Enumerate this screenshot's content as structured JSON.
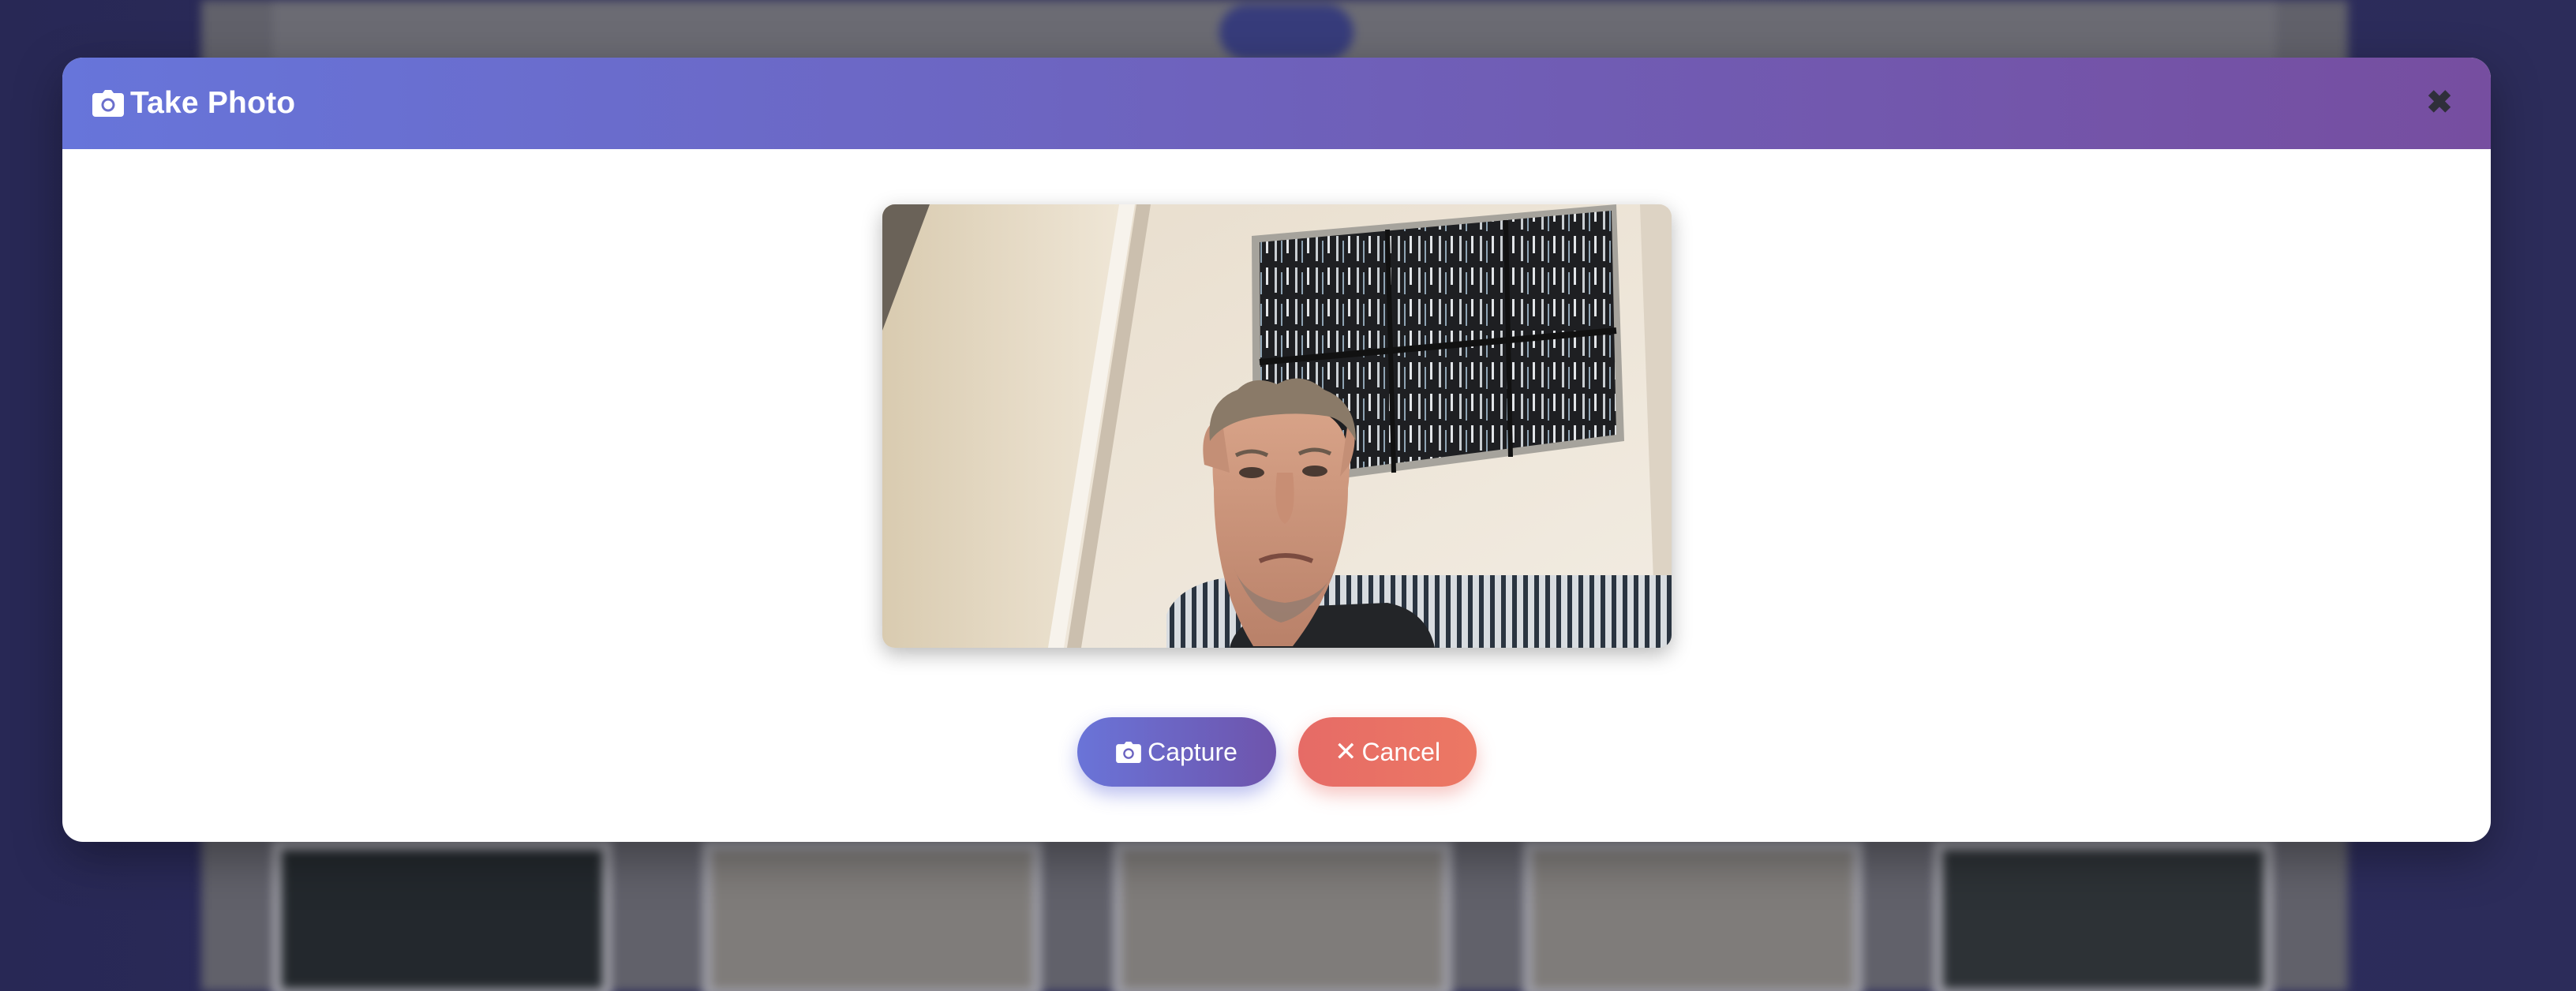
{
  "modal": {
    "title": "Take Photo",
    "title_icon": "camera-icon",
    "close_icon": "close-icon",
    "close_glyph": "✖"
  },
  "preview": {
    "content": "live webcam feed"
  },
  "actions": {
    "capture_label": "Capture",
    "capture_icon": "camera-icon",
    "cancel_label": "Cancel",
    "cancel_glyph": "✕",
    "cancel_icon": "close-icon"
  },
  "colors": {
    "header_gradient_start": "#6775da",
    "header_gradient_end": "#764ea0",
    "capture_button": "#6a74d8",
    "cancel_button": "#e66b66",
    "backdrop": "#3b3b78"
  }
}
